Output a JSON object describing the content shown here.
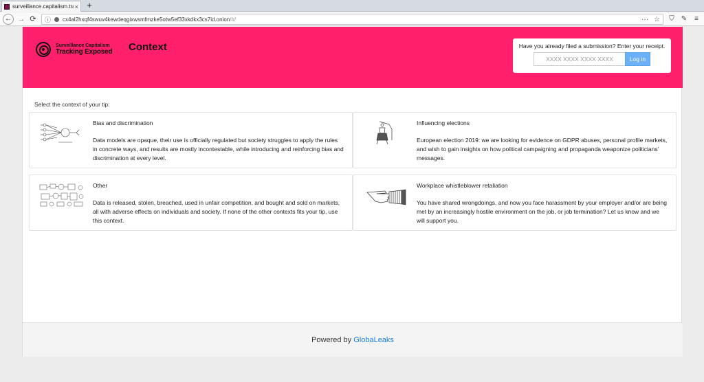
{
  "browser": {
    "tab_title": "surveillance.capitalism.trac",
    "tab_close": "×",
    "new_tab": "+",
    "url_prefix": "cx4al2hxqf4swuv4kewdeqgixwsmfmzke5otw5ef33xkdkx3cs7id.onion",
    "url_suffix": "/#/",
    "nav_back": "←",
    "nav_forward": "→",
    "nav_reload": "⟳",
    "url_info": "ⓘ",
    "page_actions": "···",
    "bookmark": "☆",
    "shield": "⛉",
    "extension": "✎",
    "menu": "≡"
  },
  "header": {
    "logo_line1": "Surveillance Capitalism",
    "logo_line2": "Tracking Exposed",
    "title": "Context",
    "receipt_prompt": "Have you already filed a submission? Enter your receipt.",
    "receipt_placeholder": "XXXX XXXX XXXX XXXX",
    "login_label": "Log in",
    "accent_color": "#ff1f6b"
  },
  "main": {
    "select_label": "Select the context of your tip:",
    "contexts": [
      {
        "title": "Bias and discrimination",
        "description": "Data models are opaque, their use is officially regulated but society struggles to apply the rules in concrete ways, and results are mostly incontestable, while introducing and reinforcing bias and discrimination at every level.",
        "icon": "neural-network-diagram"
      },
      {
        "title": "Influencing elections",
        "description": "European election 2019: we are looking for evidence on GDPR abuses, personal profile markets, and wish to gain insights on how political campaigning and propaganda weaponize politicians’ messages.",
        "icon": "speaker-podium-illustration"
      },
      {
        "title": "Other",
        "description": "Data is released, stolen, breached, used in unfair competition, and bought and sold on markets, all with adverse effects on individuals and society. If none of the other contexts fits your tip, use this context.",
        "icon": "mechanism-sketch"
      },
      {
        "title": "Workplace whistleblower retaliation",
        "description": "You have shared wrongdoings, and now you face harassment by your employer and/or are being met by an increasingly hostile environment on the job, or job termination? Let us know and we will support you.",
        "icon": "pointing-hand-illustration"
      }
    ]
  },
  "footer": {
    "text": "Powered by",
    "link": "GlobaLeaks",
    "link_color": "#1a7fe0"
  }
}
